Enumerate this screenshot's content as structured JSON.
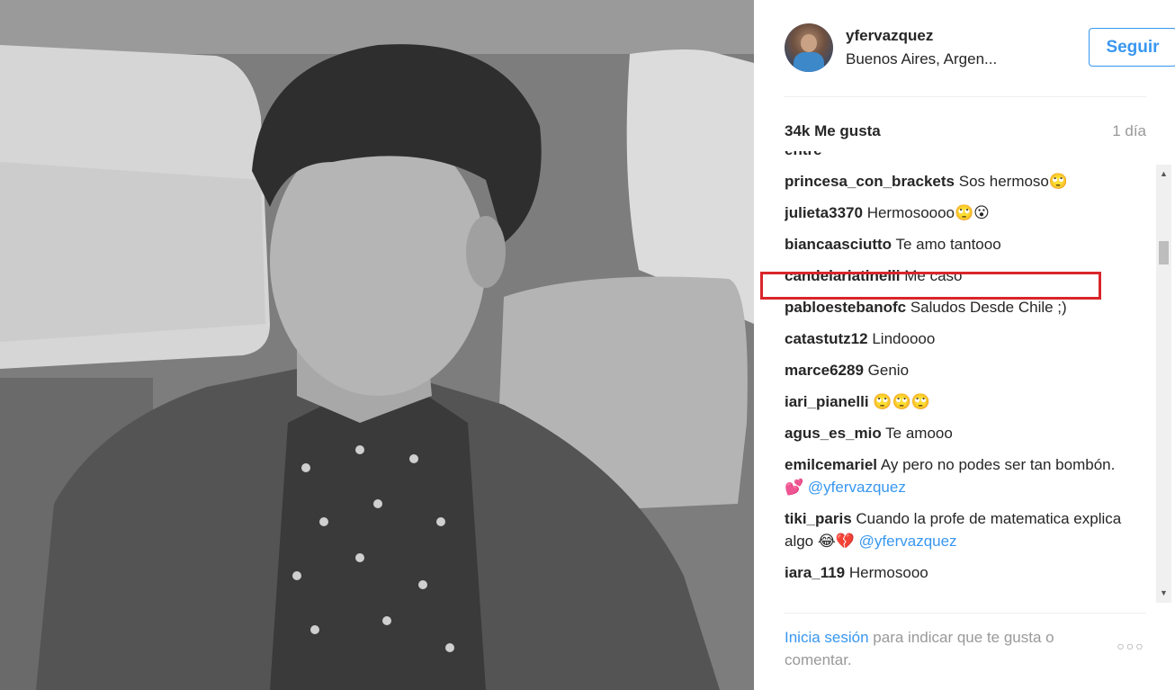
{
  "post": {
    "username": "yfervazquez",
    "location": "Buenos Aires, Argen...",
    "follow_label": "Seguir",
    "likes": "34k Me gusta",
    "time": "1 día"
  },
  "comments": [
    {
      "user": "entre",
      "text": ""
    },
    {
      "user": "princesa_con_brackets",
      "text": "Sos hermoso🙄"
    },
    {
      "user": "julieta3370",
      "text": "Hermosoooo🙄😮"
    },
    {
      "user": "biancaasciutto",
      "text": "Te amo tantooo"
    },
    {
      "user": "candelariatinelli",
      "text": "Me caso"
    },
    {
      "user": "pabloestebanofc",
      "text": "Saludos Desde Chile ;)"
    },
    {
      "user": "catastutz12",
      "text": "Lindoooo"
    },
    {
      "user": "marce6289",
      "text": "Genio"
    },
    {
      "user": "iari_pianelli",
      "text": "🙄🙄🙄"
    },
    {
      "user": "agus_es_mio",
      "text": "Te amooo"
    },
    {
      "user": "emilcemariel",
      "text": "Ay pero no podes ser tan bombón. 💕",
      "mention": "@yfervazquez"
    },
    {
      "user": "tiki_paris",
      "text": "Cuando la profe de matematica explica algo 😂💔",
      "mention": "@yfervazquez"
    },
    {
      "user": "iara_119",
      "text": "Hermosooo"
    }
  ],
  "footer": {
    "login_link": "Inicia sesión",
    "login_rest": "para indicar que te gusta o comentar.",
    "more_label": "○○○"
  },
  "icons": {
    "scroll_up": "scroll-up-arrow-icon",
    "scroll_down": "scroll-down-arrow-icon"
  },
  "colors": {
    "accent": "#3897f0",
    "highlight": "#d9262b",
    "muted": "#999999"
  }
}
